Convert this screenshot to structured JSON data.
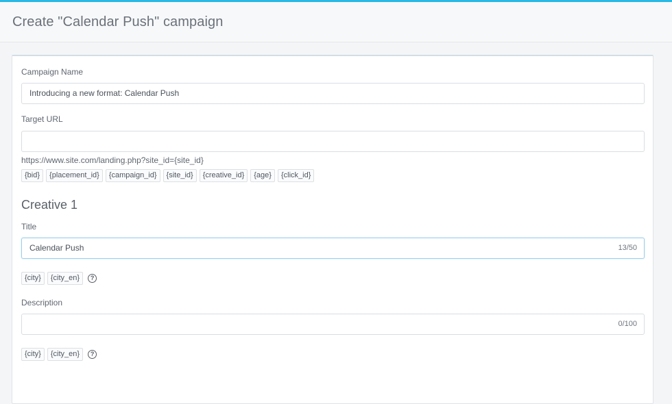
{
  "header": {
    "title": "Create \"Calendar Push\" campaign",
    "accent_color": "#2ab8e6"
  },
  "form": {
    "campaign_name": {
      "label": "Campaign Name",
      "value": "Introducing a new format: Calendar Push"
    },
    "target_url": {
      "label": "Target URL",
      "value": "",
      "hint": "https://www.site.com/landing.php?site_id={site_id}",
      "macros": [
        "{bid}",
        "{placement_id}",
        "{campaign_id}",
        "{site_id}",
        "{creative_id}",
        "{age}",
        "{click_id}"
      ]
    },
    "creative": {
      "heading": "Creative 1",
      "title": {
        "label": "Title",
        "value": "Calendar Push",
        "counter": "13/50",
        "macros": [
          "{city}",
          "{city_en}"
        ],
        "help_icon": "question-circle-icon"
      },
      "description": {
        "label": "Description",
        "value": "",
        "counter": "0/100",
        "macros": [
          "{city}",
          "{city_en}"
        ],
        "help_icon": "question-circle-icon"
      }
    }
  }
}
